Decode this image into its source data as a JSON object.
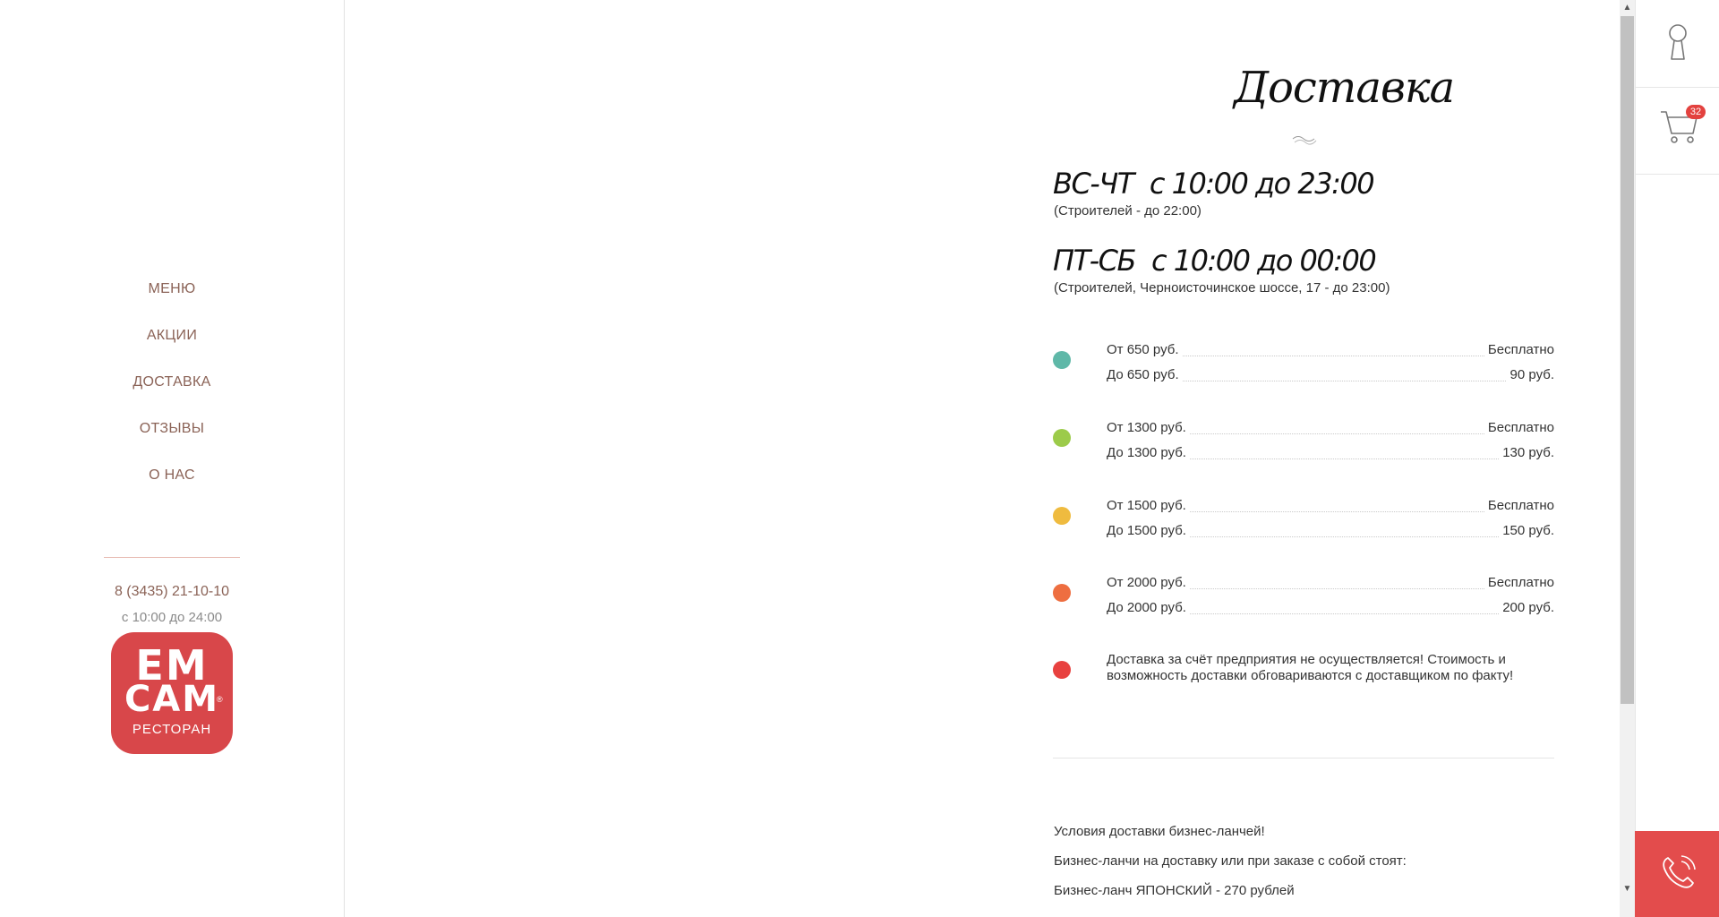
{
  "nav": {
    "items": [
      {
        "label": "МЕНЮ"
      },
      {
        "label": "АКЦИИ"
      },
      {
        "label": "ДОСТАВКА"
      },
      {
        "label": "ОТЗЫВЫ"
      },
      {
        "label": "О НАС"
      }
    ]
  },
  "contact": {
    "phone": "8 (3435) 21-10-10",
    "hours": "с 10:00 до 24:00"
  },
  "logo": {
    "line1": "ЕМ",
    "line2": "САМ",
    "line3": "РЕСТОРАН",
    "reg": "®"
  },
  "page": {
    "title": "Доставка"
  },
  "schedule": [
    {
      "days": "ВС-ЧТ",
      "time": "с 10:00 до 23:00",
      "note": "(Строителей - до 22:00)"
    },
    {
      "days": "ПТ-СБ",
      "time": "с 10:00 до 00:00",
      "note": "(Строителей, Черноисточинское шоссе, 17 - до 23:00)"
    }
  ],
  "tiers": [
    {
      "color": "#5fb8a8",
      "rows": [
        {
          "label": "От 650 руб.",
          "value": "Бесплатно"
        },
        {
          "label": "До 650 руб.",
          "value": "90 руб."
        }
      ]
    },
    {
      "color": "#9ccb4a",
      "rows": [
        {
          "label": "От 1300 руб.",
          "value": "Бесплатно"
        },
        {
          "label": "До 1300 руб.",
          "value": "130 руб."
        }
      ]
    },
    {
      "color": "#efbb3f",
      "rows": [
        {
          "label": "От 1500 руб.",
          "value": "Бесплатно"
        },
        {
          "label": "До 1500 руб.",
          "value": "150 руб."
        }
      ]
    },
    {
      "color": "#ee6e40",
      "rows": [
        {
          "label": "От 2000 руб.",
          "value": "Бесплатно"
        },
        {
          "label": "До 2000 руб.",
          "value": "200 руб."
        }
      ]
    }
  ],
  "note": {
    "color": "#e8413f",
    "text": "Доставка за счёт предприятия не осуществляется! Стоимость и возможность доставки обговариваются с доставщиком по факту!"
  },
  "business_lunch": {
    "p1": "Условия доставки бизнес-ланчей!",
    "p2": "Бизнес-ланчи на доставку или при заказе с собой стоят:",
    "p3": "Бизнес-ланч ЯПОНСКИЙ - 270 рублей"
  },
  "cart": {
    "count": "32"
  },
  "colors": {
    "accent": "#e34c4c",
    "nav_text": "#8b6357"
  }
}
